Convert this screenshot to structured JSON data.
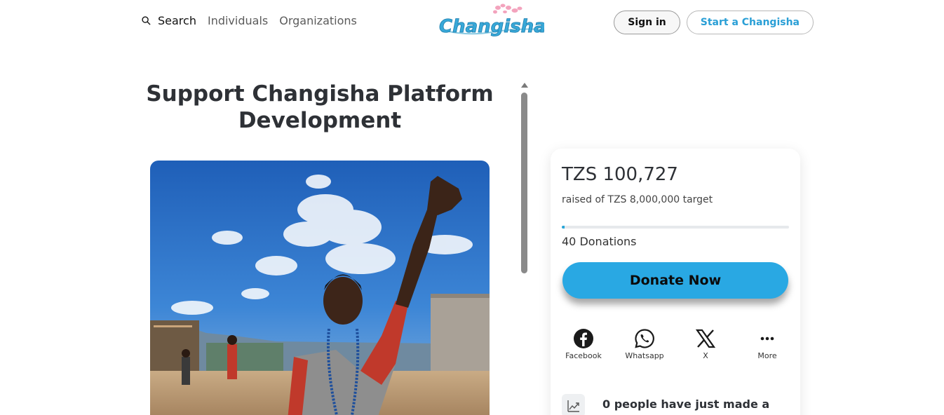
{
  "header": {
    "search_label": "Search",
    "nav_links": [
      "Individuals",
      "Organizations"
    ],
    "logo_text": "Changisha",
    "signin_label": "Sign in",
    "start_label": "Start a Changisha"
  },
  "campaign": {
    "title": "Support Changisha Platform Development"
  },
  "card": {
    "amount": "TZS 100,727",
    "target_text": "raised of TZS 8,000,000 target",
    "progress_fraction": 0.0126,
    "donations_text": "40 Donations",
    "donate_label": "Donate Now",
    "share": [
      {
        "label": "Facebook",
        "icon": "facebook-icon"
      },
      {
        "label": "Whatsapp",
        "icon": "whatsapp-icon"
      },
      {
        "label": "X",
        "icon": "x-icon"
      },
      {
        "label": "More",
        "icon": "more-icon"
      }
    ],
    "activity_text": "0 people have just made a"
  },
  "colors": {
    "accent": "#29a8e3",
    "title": "#2e3136",
    "logo_pink": "#f3a3bd"
  }
}
